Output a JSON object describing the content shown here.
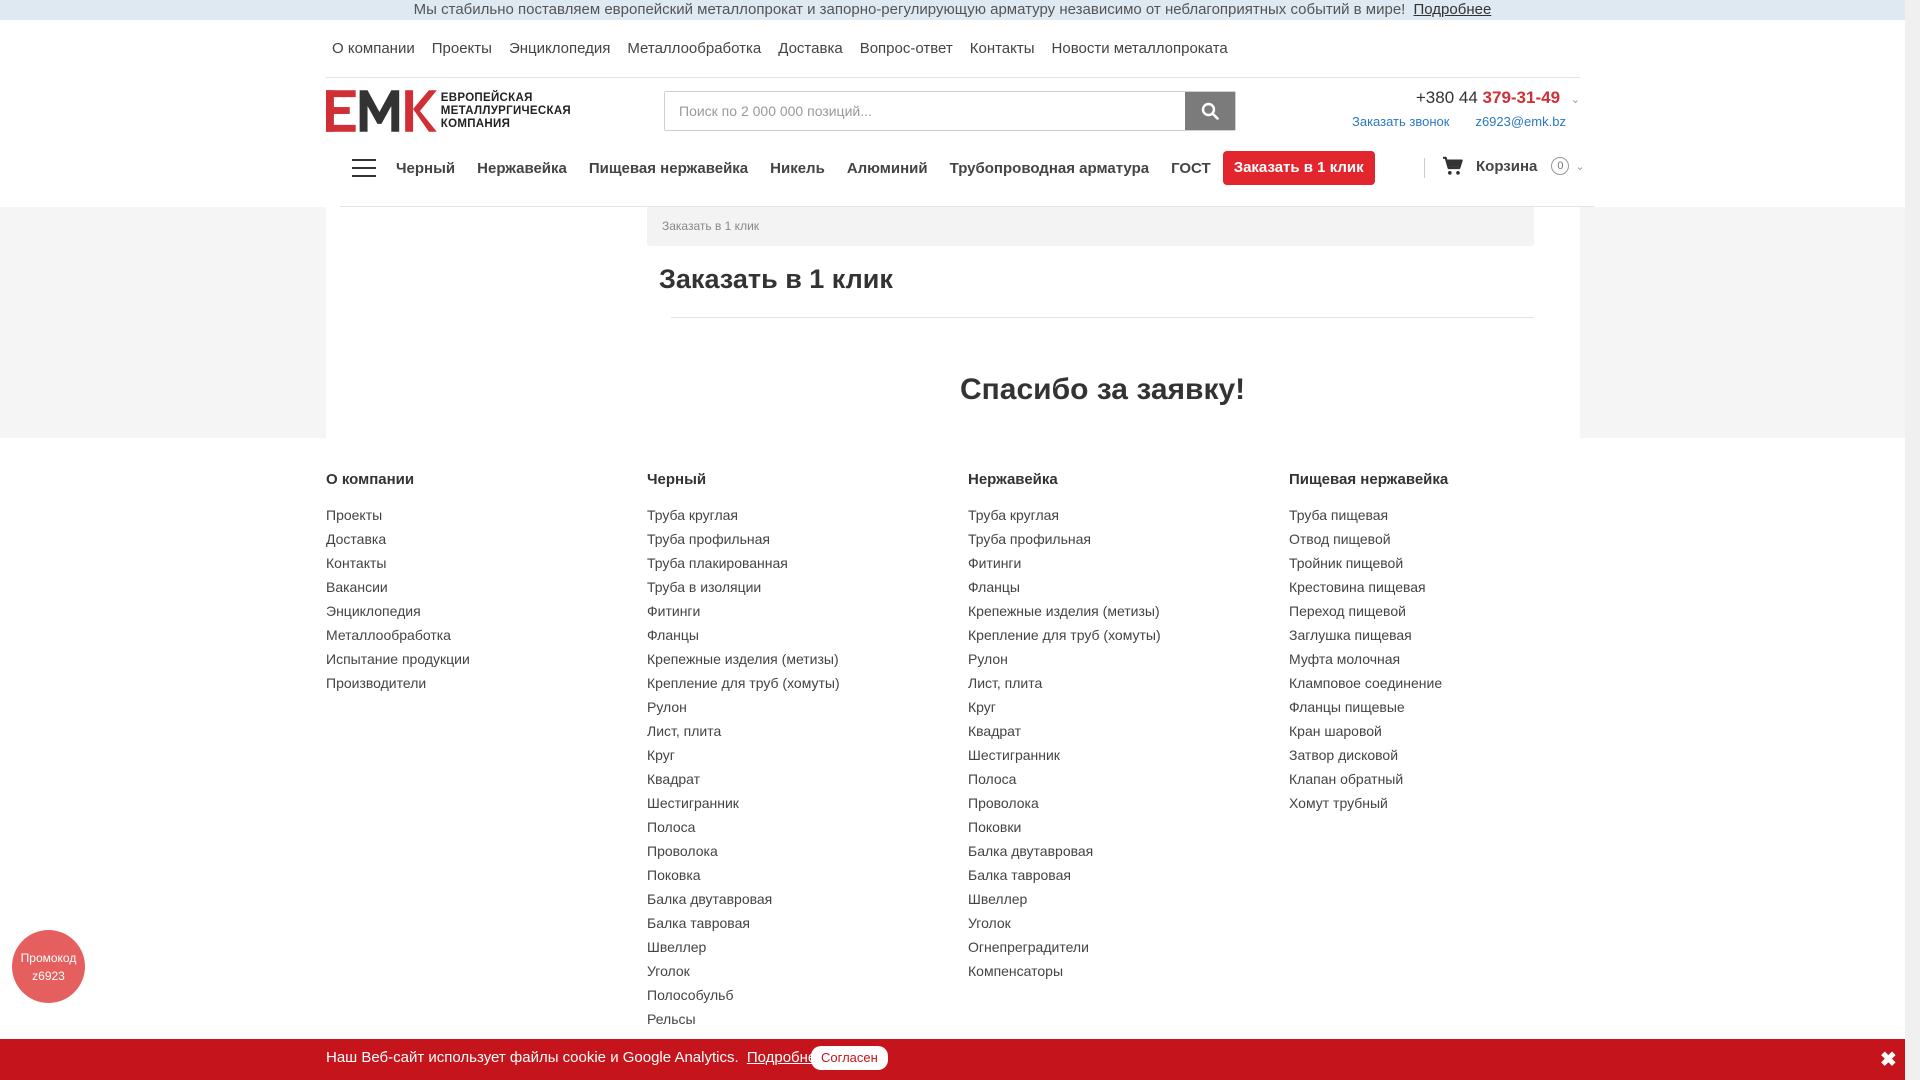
{
  "notice": {
    "text": "Мы стабильно поставляем европейский металлопрокат и запорно-регулирующую арматуру независимо от неблагоприятных событий в мире!",
    "link": "Подробнее"
  },
  "topnav": [
    "О компании",
    "Проекты",
    "Энциклопедия",
    "Металлообработка",
    "Доставка",
    "Вопрос-ответ",
    "Контакты",
    "Новости металлопроката"
  ],
  "logo": {
    "mark": "EMK",
    "line1": "ЕВРОПЕЙСКАЯ",
    "line2": "МЕТАЛЛУРГИЧЕСКАЯ",
    "line3": "КОМПАНИЯ",
    "brand_color": "#d12f35"
  },
  "search": {
    "placeholder": "Поиск по 2 000 000 позиций...",
    "icon": "search-icon"
  },
  "phone": {
    "prefix": "+380 44",
    "number": "379-31-49",
    "chevron": "⌄"
  },
  "contacts": {
    "callback": "Заказать звонок",
    "email": "z6923@emk.bz"
  },
  "catnav": [
    "Черный",
    "Нержавейка",
    "Пищевая нержавейка",
    "Никель",
    "Алюминий",
    "Трубопроводная арматура",
    "ГОСТ"
  ],
  "order_button": "Заказать в 1 клик",
  "cart": {
    "label": "Корзина",
    "count": "0",
    "chevron": "⌄",
    "icon": "cart-icon"
  },
  "breadcrumbs": "Заказать в 1 клик",
  "page_title": "Заказать в 1 клик",
  "thanks": "Спасибо за заявку!",
  "footer": [
    {
      "title": "О компании",
      "items": [
        "Проекты",
        "Доставка",
        "Контакты",
        "Вакансии",
        "Энциклопедия",
        "Металлообработка",
        "Испытание продукции",
        "Производители"
      ]
    },
    {
      "title": "Черный",
      "items": [
        "Труба круглая",
        "Труба профильная",
        "Труба плакированная",
        "Труба в изоляции",
        "Фитинги",
        "Фланцы",
        "Крепежные изделия (метизы)",
        "Крепление для труб (хомуты)",
        "Рулон",
        "Лист, плита",
        "Круг",
        "Квадрат",
        "Шестигранник",
        "Полоса",
        "Проволока",
        "Поковка",
        "Балка двутавровая",
        "Балка тавровая",
        "Швеллер",
        "Уголок",
        "Полособульб",
        "Рельсы"
      ]
    },
    {
      "title": "Нержавейка",
      "items": [
        "Труба круглая",
        "Труба профильная",
        "Фитинги",
        "Фланцы",
        "Крепежные изделия (метизы)",
        "Крепление для труб (хомуты)",
        "Рулон",
        "Лист, плита",
        "Круг",
        "Квадрат",
        "Шестигранник",
        "Полоса",
        "Проволока",
        "Поковки",
        "Балка двутавровая",
        "Балка тавровая",
        "Швеллер",
        "Уголок",
        "Огнепреградители",
        "Компенсаторы"
      ]
    },
    {
      "title": "Пищевая нержавейка",
      "items": [
        "Труба пищевая",
        "Отвод пищевой",
        "Тройник пищевой",
        "Крестовина пищевая",
        "Переход пищевой",
        "Заглушка пищевая",
        "Муфта молочная",
        "Кламповое соединение",
        "Фланцы пищевые",
        "Кран шаровой",
        "Затвор дисковой",
        "Клапан обратный",
        "Хомут трубный"
      ]
    }
  ],
  "promo": {
    "line1": "Промокод",
    "line2": "z6923"
  },
  "cookie": {
    "text": "Наш Веб-сайт использует файлы cookie и Google Analytics.",
    "link": "Подробнее",
    "agree": "Согласен",
    "close": "✖"
  },
  "colors": {
    "accent": "#e3262d",
    "link": "#2a78c2",
    "cookie_bar": "#c5141c",
    "notice_bar": "#dfe9f2"
  }
}
